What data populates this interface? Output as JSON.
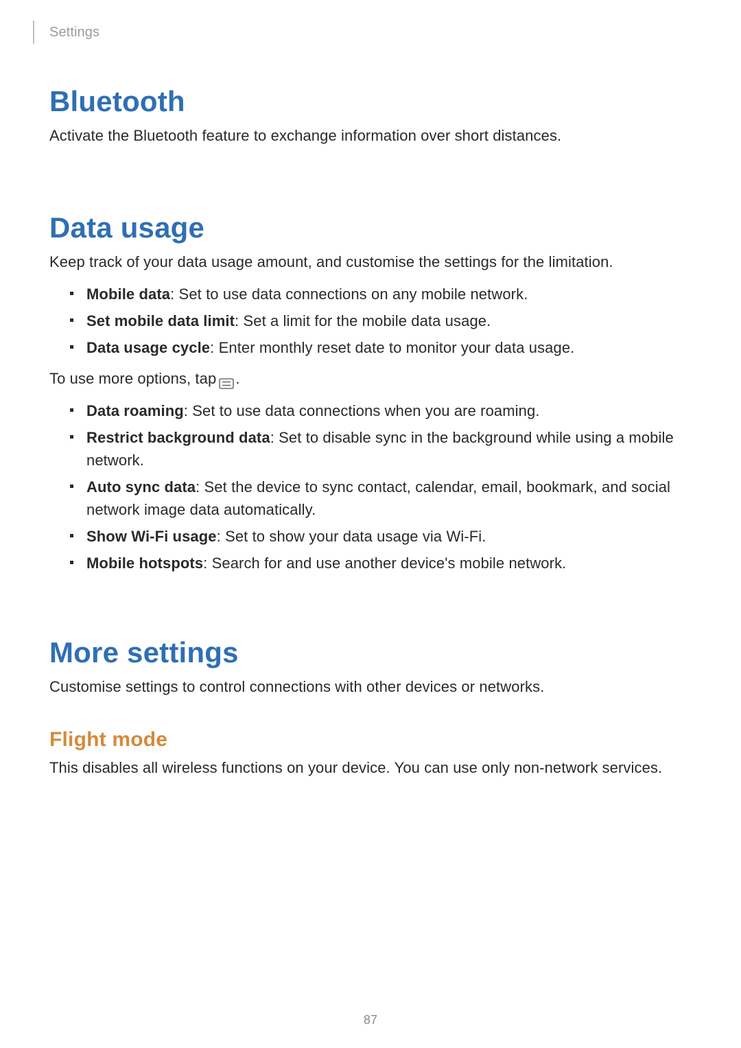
{
  "header": {
    "breadcrumb": "Settings"
  },
  "sections": {
    "bluetooth": {
      "title": "Bluetooth",
      "desc": "Activate the Bluetooth feature to exchange information over short distances."
    },
    "data_usage": {
      "title": "Data usage",
      "desc": "Keep track of your data usage amount, and customise the settings for the limitation.",
      "items1": [
        {
          "term": "Mobile data",
          "text": ": Set to use data connections on any mobile network."
        },
        {
          "term": "Set mobile data limit",
          "text": ": Set a limit for the mobile data usage."
        },
        {
          "term": "Data usage cycle",
          "text": ": Enter monthly reset date to monitor your data usage."
        }
      ],
      "options_prefix": "To use more options, tap ",
      "options_suffix": ".",
      "items2": [
        {
          "term": "Data roaming",
          "text": ": Set to use data connections when you are roaming."
        },
        {
          "term": "Restrict background data",
          "text": ": Set to disable sync in the background while using a mobile network."
        },
        {
          "term": "Auto sync data",
          "text": ": Set the device to sync contact, calendar, email, bookmark, and social network image data automatically."
        },
        {
          "term": "Show Wi-Fi usage",
          "text": ": Set to show your data usage via Wi-Fi."
        },
        {
          "term": "Mobile hotspots",
          "text": ": Search for and use another device's mobile network."
        }
      ]
    },
    "more_settings": {
      "title": "More settings",
      "desc": "Customise settings to control connections with other devices or networks.",
      "flight_mode": {
        "title": "Flight mode",
        "desc": "This disables all wireless functions on your device. You can use only non-network services."
      }
    }
  },
  "page_number": "87"
}
